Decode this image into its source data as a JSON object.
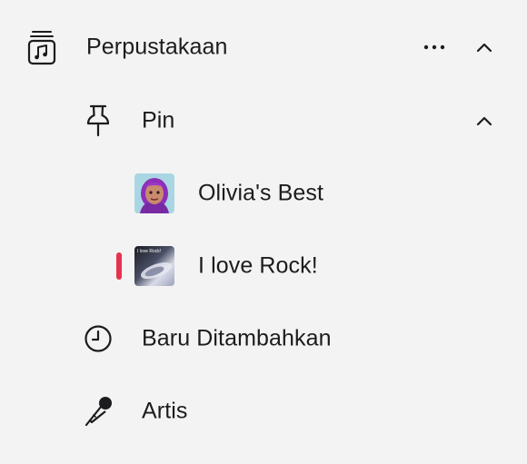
{
  "library": {
    "label": "Perpustakaan",
    "icon": "music-library-icon",
    "more_icon": "more-icon",
    "chevron_icon": "chevron-up-icon"
  },
  "pinned": {
    "label": "Pin",
    "icon": "pin-icon",
    "chevron_icon": "chevron-up-icon",
    "items": [
      {
        "label": "Olivia's Best",
        "art": "avatar-artwork"
      },
      {
        "label": "I love Rock!",
        "art": "rock-playlist-artwork",
        "art_caption": "I love Rock!",
        "active": true
      }
    ]
  },
  "recently_added": {
    "label": "Baru Ditambahkan",
    "icon": "clock-icon"
  },
  "artists": {
    "label": "Artis",
    "icon": "microphone-icon"
  },
  "colors": {
    "background": "#f3f3f3",
    "text": "#1c1c1e",
    "accent": "#e8314f"
  }
}
